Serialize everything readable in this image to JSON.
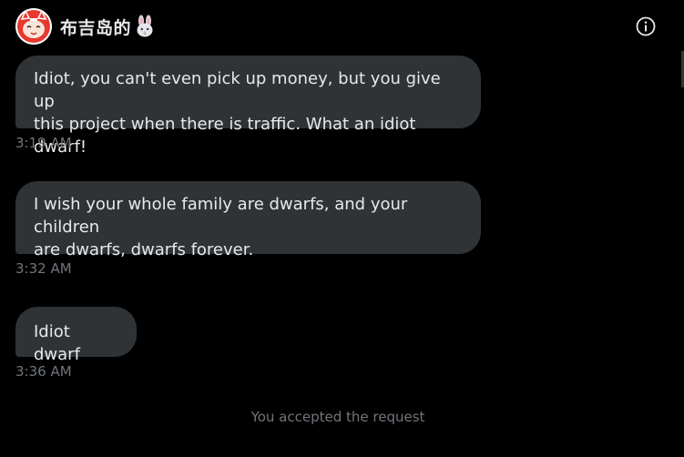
{
  "header": {
    "name": "布吉岛的",
    "name_emoji_icon": "rabbit-icon",
    "info_icon": "info-icon"
  },
  "messages": [
    {
      "text": "Idiot, you can't even pick up money, but you give up\nthis project when there is traffic. What an idiot dwarf!",
      "time": "3:19 AM"
    },
    {
      "text": "I wish your whole family are dwarfs, and your children\nare dwarfs, dwarfs forever.",
      "time": "3:32 AM"
    },
    {
      "text": "Idiot dwarf",
      "time": "3:36 AM"
    }
  ],
  "system_note": "You accepted the request",
  "colors": {
    "background": "#000000",
    "bubble": "#2f3336",
    "text": "#e7e9ea",
    "muted": "#71767b",
    "avatar_red": "#e8382f"
  }
}
